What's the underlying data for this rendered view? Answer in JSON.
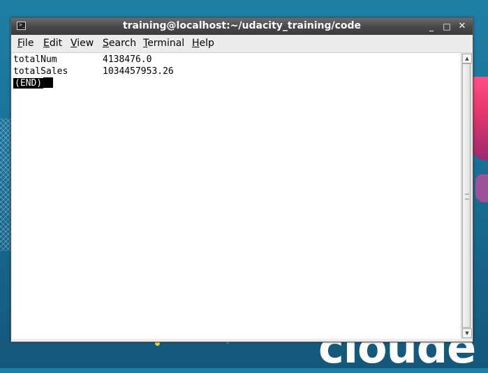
{
  "window": {
    "title": "training@localhost:~/udacity_training/code",
    "icon": "terminal-icon",
    "controls": {
      "minimize": "_",
      "maximize": "□",
      "close": "✕"
    }
  },
  "menubar": {
    "items": [
      {
        "label": "File",
        "mnemonic": "F",
        "rest": "ile"
      },
      {
        "label": "Edit",
        "mnemonic": "E",
        "rest": "dit"
      },
      {
        "label": "View",
        "mnemonic": "V",
        "rest": "iew"
      },
      {
        "label": "Search",
        "mnemonic": "S",
        "rest": "earch"
      },
      {
        "label": "Terminal",
        "mnemonic": "T",
        "rest": "erminal"
      },
      {
        "label": "Help",
        "mnemonic": "H",
        "rest": "elp"
      }
    ]
  },
  "terminal": {
    "rows": [
      {
        "key": "totalNum",
        "value": "4138476.0"
      },
      {
        "key": "totalSales",
        "value": "1034457953.26"
      }
    ],
    "end_marker": "(END)"
  },
  "desktop": {
    "brand_text": "cloude"
  },
  "colors": {
    "desktop_bg": "#1a6f95",
    "titlebar": "#4a4a4a",
    "terminal_bg": "#ffffff",
    "brand_pink": "#e8376d"
  }
}
